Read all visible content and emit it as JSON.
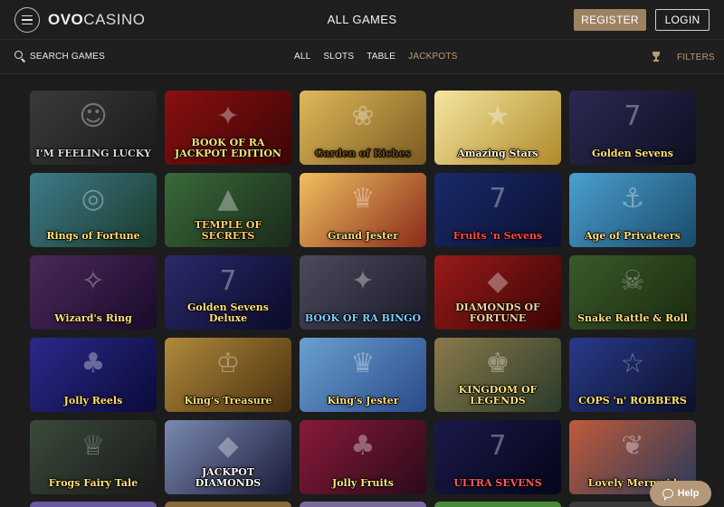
{
  "header": {
    "logo_primary": "OVO",
    "logo_secondary": "CASINO",
    "title": "ALL GAMES",
    "register_label": "REGISTER",
    "login_label": "LOGIN"
  },
  "filterbar": {
    "search_label": "SEARCH GAMES",
    "tabs": [
      {
        "label": "ALL",
        "active": false
      },
      {
        "label": "SLOTS",
        "active": false
      },
      {
        "label": "TABLE",
        "active": false
      },
      {
        "label": "JACKPOTS",
        "active": true
      }
    ],
    "filters_label": "FILTERS"
  },
  "colors": {
    "accent": "#b99c78",
    "register_bg": "#9d8262",
    "background": "#1c1c1c"
  },
  "games": [
    {
      "title": "I'M FEELING LUCKY",
      "bg": "linear-gradient(135deg,#3a3a3a,#1a1a1a)",
      "color": "#d9d9d9",
      "deco": "☺"
    },
    {
      "title": "BOOK OF RA JACKPOT EDITION",
      "bg": "linear-gradient(135deg,#8a1010,#3c0505)",
      "color": "#ffe07a",
      "deco": "✦"
    },
    {
      "title": "Garden of Riches",
      "bg": "linear-gradient(135deg,#e0b95a,#7a5a20)",
      "color": "#6a4a16",
      "deco": "❀"
    },
    {
      "title": "Amazing Stars",
      "bg": "linear-gradient(135deg,#f5e6a0,#b08a2a)",
      "color": "#fff6cc",
      "deco": "★"
    },
    {
      "title": "Golden Sevens",
      "bg": "linear-gradient(135deg,#2a2a52,#0e0e22)",
      "color": "#ffe07a",
      "deco": "7"
    },
    {
      "title": "Rings of Fortune",
      "bg": "linear-gradient(135deg,#3e7a8a,#1a3a2a)",
      "color": "#ffe07a",
      "deco": "◎"
    },
    {
      "title": "TEMPLE OF SECRETS",
      "bg": "linear-gradient(135deg,#3a6a3a,#1a2a1a)",
      "color": "#ffcf6a",
      "deco": "▲"
    },
    {
      "title": "Grand Jester",
      "bg": "linear-gradient(135deg,#f0c060,#8a2a1a)",
      "color": "#ffe07a",
      "deco": "♛"
    },
    {
      "title": "Fruits 'n Sevens",
      "bg": "linear-gradient(135deg,#1a2a6a,#0a1030)",
      "color": "#ff4a4a",
      "deco": "7"
    },
    {
      "title": "Age of Privateers",
      "bg": "linear-gradient(135deg,#4aa0d0,#1a4a6a)",
      "color": "#ffe07a",
      "deco": "⚓"
    },
    {
      "title": "Wizard's Ring",
      "bg": "linear-gradient(135deg,#4a2a5a,#1a0a2a)",
      "color": "#ffe07a",
      "deco": "✧"
    },
    {
      "title": "Golden Sevens Deluxe",
      "bg": "linear-gradient(135deg,#2a2a6a,#0a0a2a)",
      "color": "#ffe07a",
      "deco": "7"
    },
    {
      "title": "BOOK OF RA BINGO",
      "bg": "linear-gradient(135deg,#4a4a5a,#1a1a2a)",
      "color": "#7ad0ff",
      "deco": "✦"
    },
    {
      "title": "DIAMONDS OF FORTUNE",
      "bg": "linear-gradient(135deg,#9a1a1a,#3a0505)",
      "color": "#ffd0a0",
      "deco": "◆"
    },
    {
      "title": "Snake Rattle & Roll",
      "bg": "linear-gradient(135deg,#3a5a2a,#1a2a10)",
      "color": "#ffe07a",
      "deco": "☠"
    },
    {
      "title": "Jolly Reels",
      "bg": "linear-gradient(135deg,#2a2a8a,#0a0a3a)",
      "color": "#ffe07a",
      "deco": "♣"
    },
    {
      "title": "King's Treasure",
      "bg": "linear-gradient(135deg,#b08a3a,#4a3010)",
      "color": "#ffe07a",
      "deco": "♔"
    },
    {
      "title": "King's Jester",
      "bg": "linear-gradient(135deg,#6aa0d0,#2a4a8a)",
      "color": "#ffe07a",
      "deco": "♛"
    },
    {
      "title": "KINGDOM OF LEGENDS",
      "bg": "linear-gradient(135deg,#8a7a4a,#2a3a2a)",
      "color": "#ffe07a",
      "deco": "♚"
    },
    {
      "title": "COPS 'n' ROBBERS",
      "bg": "linear-gradient(135deg,#2a3a8a,#0a102a)",
      "color": "#ffe07a",
      "deco": "☆"
    },
    {
      "title": "Frogs Fairy Tale",
      "bg": "linear-gradient(135deg,#3a4a3a,#1a1a1a)",
      "color": "#ffe07a",
      "deco": "♕"
    },
    {
      "title": "JACKPOT DIAMONDS",
      "bg": "linear-gradient(135deg,#7a8ab0,#1a1a3a)",
      "color": "#ffffff",
      "deco": "◆"
    },
    {
      "title": "Jolly Fruits",
      "bg": "linear-gradient(135deg,#8a1a3a,#2a0a1a)",
      "color": "#ffe07a",
      "deco": "♣"
    },
    {
      "title": "ULTRA SEVENS",
      "bg": "linear-gradient(135deg,#1a1a4a,#05051a)",
      "color": "#ff5a5a",
      "deco": "7"
    },
    {
      "title": "Lovely Mermaid",
      "bg": "linear-gradient(135deg,#c05a3a,#2a3a5a)",
      "color": "#ffe07a",
      "deco": "❦"
    }
  ],
  "partial_row": [
    {
      "bg": "#6a5aa0"
    },
    {
      "bg": "#8a6a3a"
    },
    {
      "bg": "#7a6aa0"
    },
    {
      "bg": "#4a8a3a"
    },
    {
      "bg": "#3a3a3a"
    }
  ],
  "help": {
    "label": "Help"
  }
}
